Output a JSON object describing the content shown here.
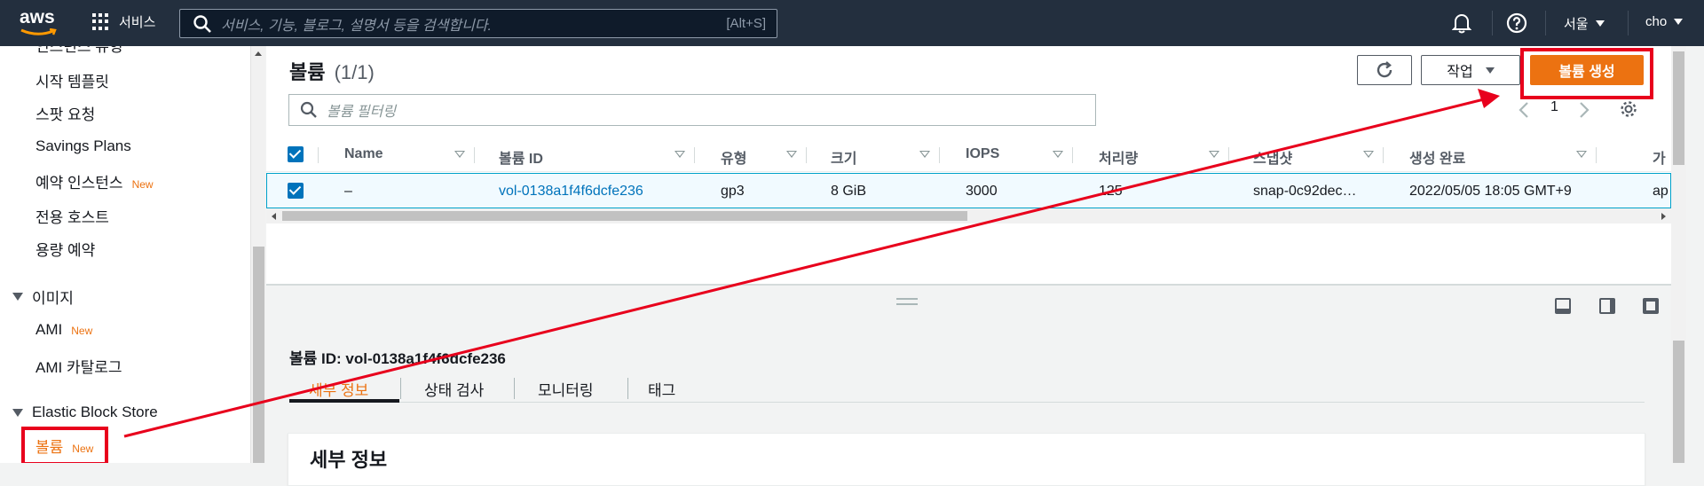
{
  "topbar": {
    "logo": "aws",
    "services_label": "서비스",
    "search_placeholder": "서비스, 기능, 블로그, 설명서 등을 검색합니다.",
    "search_shortcut": "[Alt+S]",
    "region": "서울",
    "user": "cho",
    "icons": [
      "grid-icon",
      "search-icon",
      "bell-icon",
      "help-icon"
    ]
  },
  "sidebar": {
    "items": [
      {
        "label": "인스턴스 유형",
        "new": ""
      },
      {
        "label": "시작 템플릿",
        "new": ""
      },
      {
        "label": "스팟 요청",
        "new": ""
      },
      {
        "label": "Savings Plans",
        "new": ""
      },
      {
        "label": "예약 인스턴스",
        "new": "New"
      },
      {
        "label": "전용 호스트",
        "new": ""
      },
      {
        "label": "용량 예약",
        "new": ""
      }
    ],
    "section_images": "이미지",
    "image_items": [
      {
        "label": "AMI",
        "new": "New"
      },
      {
        "label": "AMI 카탈로그",
        "new": ""
      }
    ],
    "section_ebs": "Elastic Block Store",
    "ebs_items": [
      {
        "label": "볼륨",
        "new": "New"
      }
    ]
  },
  "volumes": {
    "title": "볼륨",
    "count": "(1/1)",
    "actions_label": "작업",
    "create_label": "볼륨 생성",
    "filter_placeholder": "볼륨 필터링",
    "page": "1",
    "columns": [
      "Name",
      "볼륨 ID",
      "유형",
      "크기",
      "IOPS",
      "처리량",
      "스냅샷",
      "생성 완료",
      "가"
    ],
    "rows": [
      {
        "name": "–",
        "volume_id": "vol-0138a1f4f6dcfe236",
        "type": "gp3",
        "size": "8 GiB",
        "iops": "3000",
        "throughput": "125",
        "snapshot": "snap-0c92dec…",
        "created": "2022/05/05 18:05 GMT+9",
        "az": "ap"
      }
    ]
  },
  "details": {
    "title": "볼륨 ID: vol-0138a1f4f6dcfe236",
    "tabs": [
      "세부 정보",
      "상태 검사",
      "모니터링",
      "태그"
    ],
    "card_title": "세부 정보"
  },
  "colors": {
    "topbar": "#232f3e",
    "accent": "#ec7211",
    "link": "#0073bb",
    "annotation": "#e8001c"
  }
}
